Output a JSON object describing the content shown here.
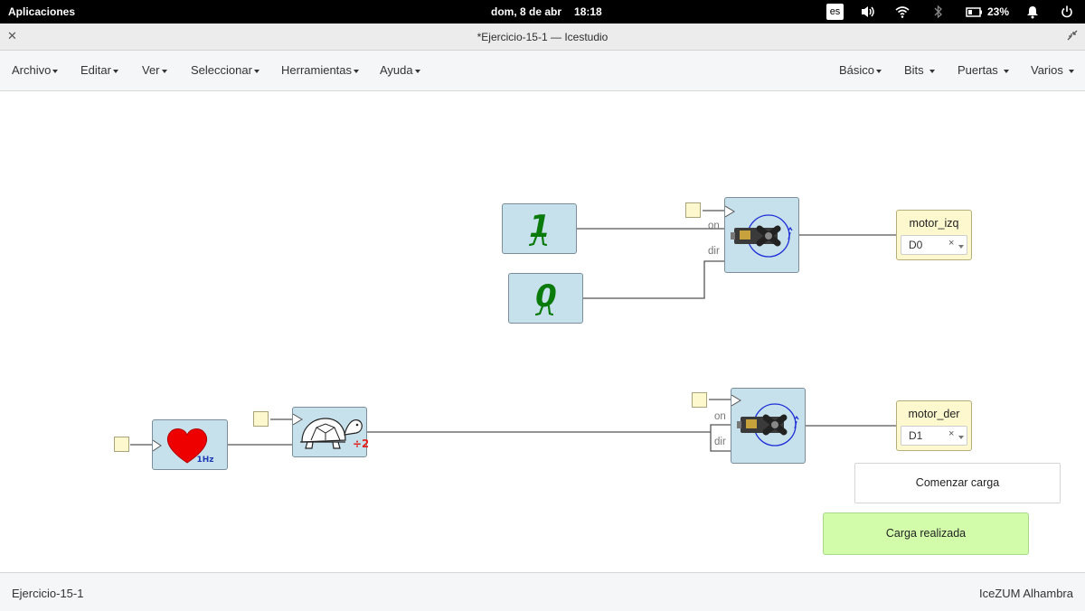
{
  "topbar": {
    "apps_label": "Aplicaciones",
    "date": "dom,  8 de abr",
    "time": "18:18",
    "keyboard_layout": "es",
    "battery_percent": "23%",
    "icons": [
      "volume-icon",
      "wifi-icon",
      "bluetooth-icon",
      "battery-icon",
      "bell-icon",
      "power-icon"
    ]
  },
  "window": {
    "title": "*Ejercicio-15-1 — Icestudio"
  },
  "menubar": {
    "left": [
      "Archivo",
      "Editar",
      "Ver",
      "Seleccionar",
      "Herramientas",
      "Ayuda"
    ],
    "right": [
      "Básico",
      "Bits",
      "Puertas",
      "Varios"
    ]
  },
  "canvas": {
    "constants": [
      {
        "value": "1"
      },
      {
        "value": "0"
      }
    ],
    "motor_ports": {
      "on": "on",
      "dir": "dir"
    },
    "heart_freq": "1Hz",
    "divider_label": "÷2",
    "outputs": [
      {
        "name": "motor_izq",
        "pin": "D0"
      },
      {
        "name": "motor_der",
        "pin": "D1"
      }
    ],
    "start_button": "Comenzar carga",
    "done_message": "Carga realizada",
    "colors": {
      "block_fill": "#c6e1ec",
      "pin_fill": "#fdf8cd",
      "done_fill": "#d2fcaa",
      "wire": "#555555",
      "const_green": "#0a7a0a"
    }
  },
  "statusbar": {
    "project": "Ejercicio-15-1",
    "board": "IceZUM Alhambra"
  }
}
